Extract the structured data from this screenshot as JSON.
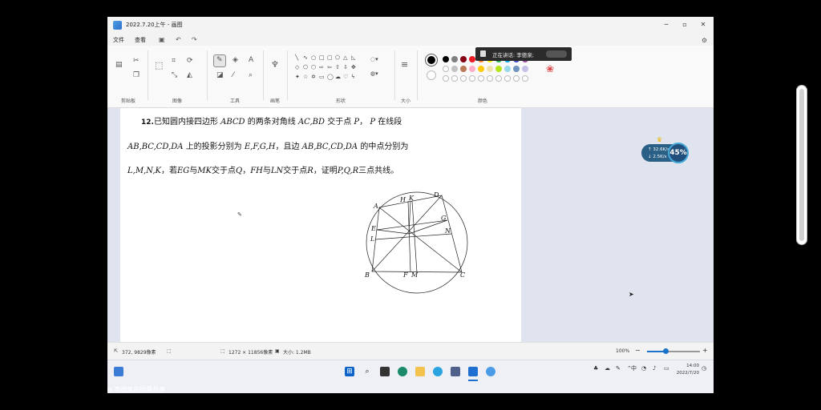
{
  "window": {
    "title": "2022.7.20上午 - 画图",
    "minimize": "─",
    "maximize": "▫",
    "close": "✕"
  },
  "menu": {
    "file": "文件",
    "view": "查看"
  },
  "call_banner": {
    "text": "正在讲话: 李德泉;"
  },
  "ribbon": {
    "groups": {
      "clipboard": "剪贴板",
      "image": "图像",
      "tools": "工具",
      "brushes": "画笔",
      "shapes": "形状",
      "size": "大小",
      "colors": "颜色"
    },
    "palette_row1": [
      "#000000",
      "#7f7f7f",
      "#880015",
      "#ed1c24",
      "#ff7f27",
      "#fff200",
      "#22b14c",
      "#00a2e8",
      "#3f48cc",
      "#a349a4"
    ],
    "palette_row2": [
      "#ffffff",
      "#c3c3c3",
      "#b97a57",
      "#ffaec9",
      "#ffc90e",
      "#efe4b0",
      "#b5e61d",
      "#99d9ea",
      "#7092be",
      "#c8bfe7"
    ]
  },
  "problem": {
    "line1": {
      "num": "12.",
      "t1": "已知圆内接四边形",
      "v1": "ABCD",
      "t2": "的两条对角线",
      "v2": "AC,BD",
      "t3": "交于点",
      "v3": "P",
      "t4": "，",
      "v4": "P",
      "t5": "在线段"
    },
    "line2": {
      "v1": "AB,BC,CD,DA",
      "t1": "上的投影分别为",
      "v2": "E,F,G,H",
      "t2": "，且边",
      "v3": "AB,BC,CD,DA",
      "t3": "的中点分别为"
    },
    "line3": {
      "v1": "L,M,N,K",
      "t1": "，若",
      "v2": "EG",
      "t2": "与",
      "v3": "MK",
      "t3": "交于点",
      "v4": "Q",
      "t4": "，",
      "v5": "FH",
      "t5": "与",
      "v6": "LN",
      "t6": "交于点",
      "v7": "R",
      "t7": "，证明",
      "v8": "P,Q,R",
      "t8": "三点共线。"
    },
    "figure_labels": {
      "A": "A",
      "B": "B",
      "C": "C",
      "D": "D",
      "H": "H",
      "K": "K",
      "E": "E",
      "L": "L",
      "G": "G",
      "N": "N",
      "F": "F",
      "M": "M"
    }
  },
  "speed_widget": {
    "up": "↑ 32.6K/s",
    "down": "↓ 2.5K/s",
    "percent": "45%"
  },
  "statusbar": {
    "cursor_pos": "372, 9829像素",
    "canvas_size": "1272 × 11856像素",
    "file_size": "大小: 1.2MB",
    "zoom": "100%",
    "zoom_fraction": 0.35
  },
  "taskbar": {
    "ime": "中",
    "time": "14:00",
    "date": "2022/7/20"
  },
  "share_caption": "李德泉的屏幕共享"
}
